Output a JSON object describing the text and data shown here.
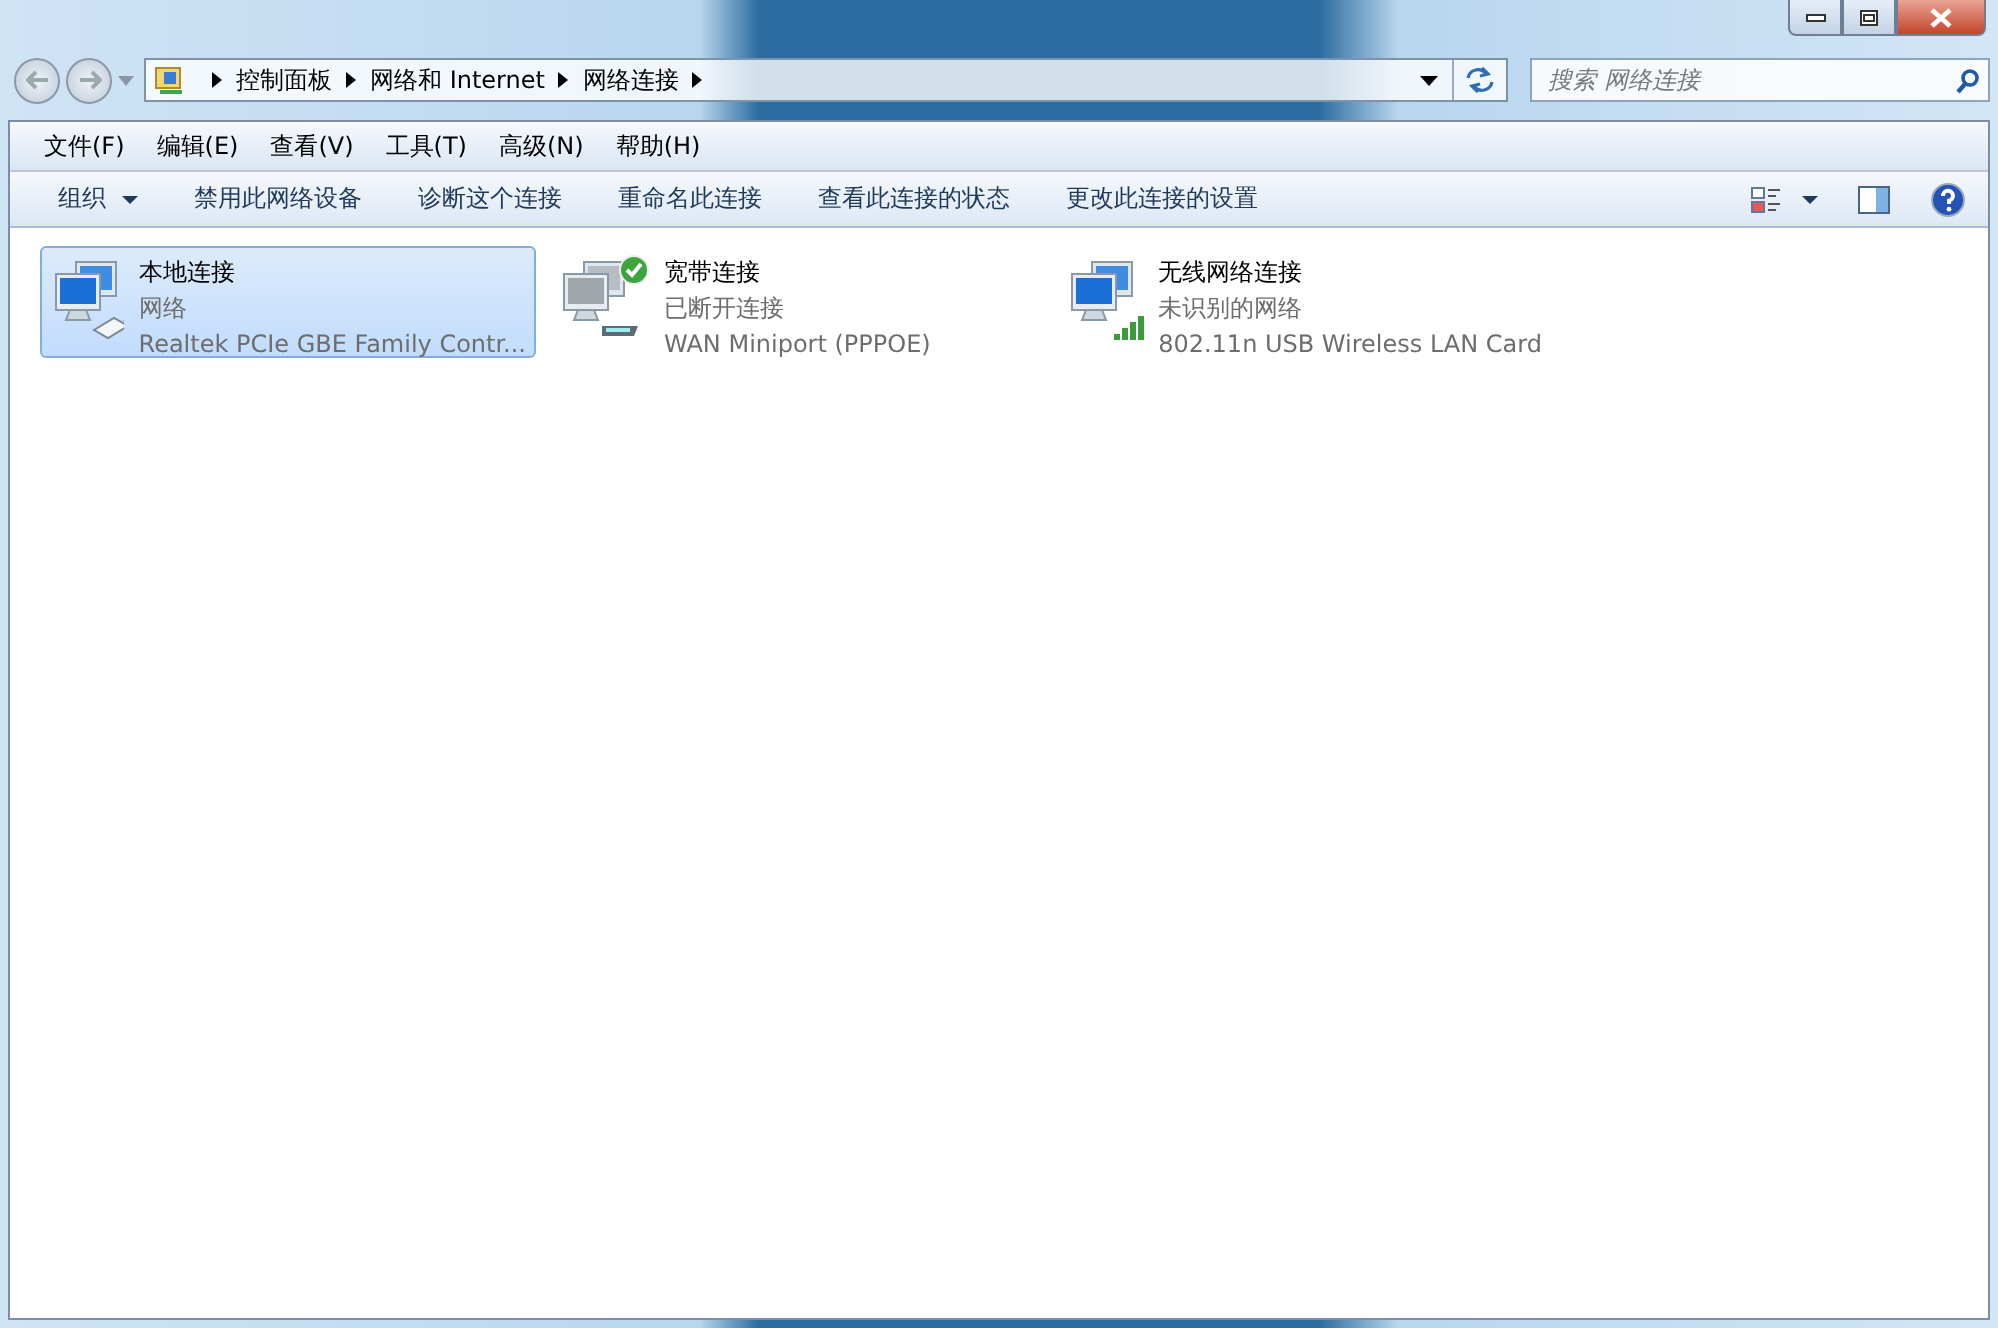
{
  "address": {
    "crumbs": [
      "控制面板",
      "网络和 Internet",
      "网络连接"
    ]
  },
  "search": {
    "placeholder": "搜索 网络连接"
  },
  "menu": [
    "文件(F)",
    "编辑(E)",
    "查看(V)",
    "工具(T)",
    "高级(N)",
    "帮助(H)"
  ],
  "toolbar": [
    {
      "label": "组织",
      "kind": "menu"
    },
    {
      "label": "禁用此网络设备",
      "kind": "action"
    },
    {
      "label": "诊断这个连接",
      "kind": "action"
    },
    {
      "label": "重命名此连接",
      "kind": "action"
    },
    {
      "label": "查看此连接的状态",
      "kind": "action"
    },
    {
      "label": "更改此连接的设置",
      "kind": "action"
    }
  ],
  "connections": [
    {
      "name": "本地连接",
      "status": "网络",
      "device": "Realtek PCIe GBE Family Contr...",
      "kind": "ethernet",
      "selected": true
    },
    {
      "name": "宽带连接",
      "status": "已断开连接",
      "device": "WAN Miniport (PPPOE)",
      "kind": "broadband",
      "selected": false
    },
    {
      "name": "无线网络连接",
      "status": "未识别的网络",
      "device": "802.11n USB Wireless LAN Card",
      "kind": "wireless",
      "selected": false
    }
  ]
}
